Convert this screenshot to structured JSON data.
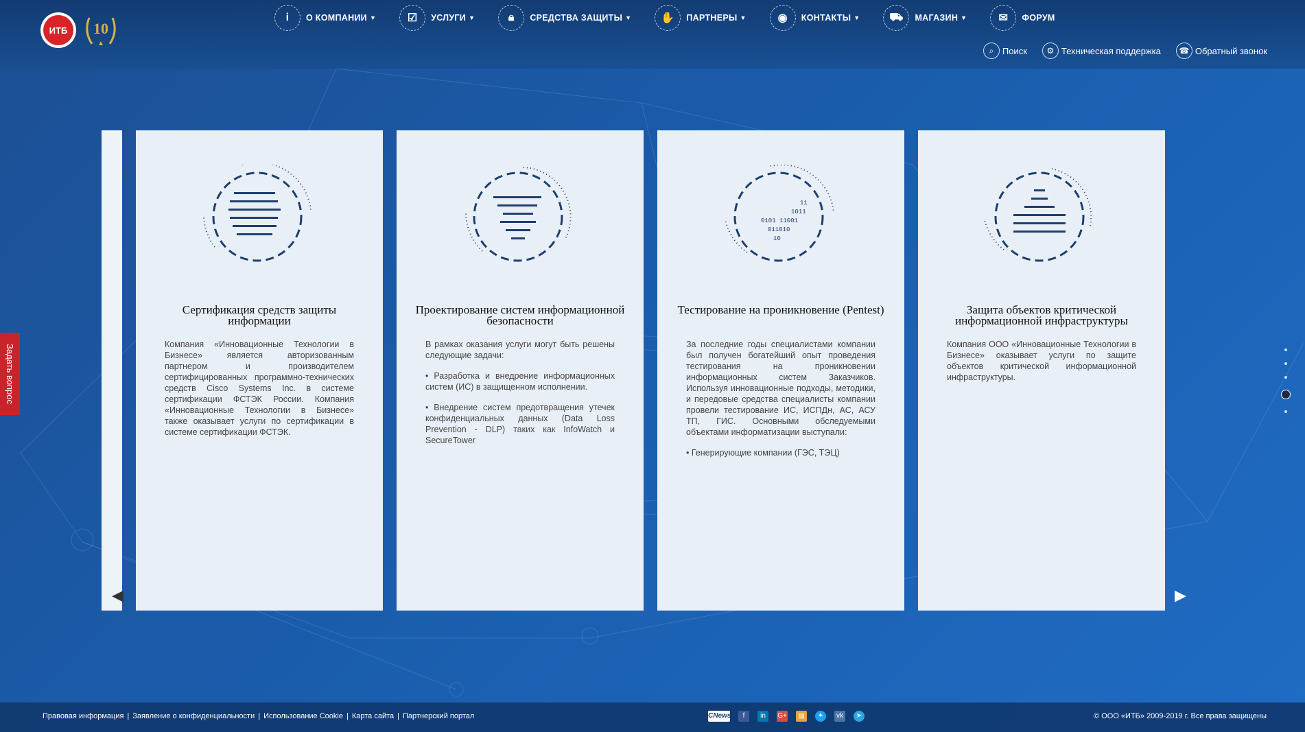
{
  "brand": {
    "logo_text": "ИТБ",
    "anniversary": "10"
  },
  "nav": [
    {
      "label": "О КОМПАНИИ",
      "icon": "info-icon"
    },
    {
      "label": "УСЛУГИ",
      "icon": "checklist-icon"
    },
    {
      "label": "СРЕДСТВА ЗАЩИТЫ",
      "icon": "lock-icon"
    },
    {
      "label": "ПАРТНЕРЫ",
      "icon": "handshake-icon"
    },
    {
      "label": "КОНТАКТЫ",
      "icon": "location-icon"
    },
    {
      "label": "МАГАЗИН",
      "icon": "cart-icon"
    },
    {
      "label": "ФОРУМ",
      "icon": "chat-icon"
    }
  ],
  "subnav": [
    {
      "label": "Поиск",
      "icon": "search-icon"
    },
    {
      "label": "Техническая поддержка",
      "icon": "gear-icon"
    },
    {
      "label": "Обратный звонок",
      "icon": "phone-icon"
    }
  ],
  "ask_tab": "Задать вопрос",
  "cards": [
    {
      "title": "Сертификация средств защиты информации",
      "paragraphs": [
        "Компания «Инновационные Технологии в Бизнесе» является авторизованным партнером и производителем сертифицированных программно-технических средств Cisco Systems Inc. в системе сертификации ФСТЭК России. Компания «Инновационные Технологии в Бизнесе» также оказывает услуги по сертификации в системе сертификации ФСТЭК."
      ],
      "bullets": []
    },
    {
      "title": "Проектирование систем информационной безопасности",
      "paragraphs": [
        "В рамках оказания услуги могут быть решены следующие задачи:"
      ],
      "bullets": [
        "Разработка и внедрение информационных систем (ИС) в защищенном исполнении.",
        "Внедрение систем предотвращения утечек конфиденциальных данных (Data Loss Prevention - DLP) таких как InfoWatch и SecureTower"
      ]
    },
    {
      "title": "Тестирование на проникновение (Pentest)",
      "paragraphs": [
        "За последние годы специалистами компании был получен богатейший опыт проведения тестирования на проникновении информационных систем Заказчиков. Используя инновационные подходы, методики, и передовые средства специалисты компании провели тестирование ИС, ИСПДн, АС, АСУ ТП, ГИС. Основными обследуемыми объектами информатизации выступали:"
      ],
      "bullets": [
        "Генерирующие компании (ГЭС, ТЭЦ)"
      ],
      "binary": [
        "11",
        "1011",
        "0101 11001",
        "011010",
        "10"
      ]
    },
    {
      "title": "Защита объектов критической информационной инфраструктуры",
      "paragraphs": [
        "Компания ООО «Инновационные Технологии в Бизнесе» оказывает услуги по защите объектов критической информационной инфраструктуры."
      ],
      "bullets": []
    }
  ],
  "footer": {
    "links": [
      "Правовая информация",
      "Заявление о конфиденциальности",
      "Использование Cookie",
      "Карта сайта",
      "Партнерский портал"
    ],
    "socials": [
      {
        "label": "CNews",
        "icon": "cnews-icon"
      },
      {
        "label": "f",
        "icon": "facebook-icon"
      },
      {
        "label": "in",
        "icon": "linkedin-icon"
      },
      {
        "label": "G+",
        "icon": "googleplus-icon"
      },
      {
        "label": "",
        "icon": "habr-icon"
      },
      {
        "label": "",
        "icon": "twitter-icon"
      },
      {
        "label": "vk",
        "icon": "vk-icon"
      },
      {
        "label": "",
        "icon": "telegram-icon"
      }
    ],
    "copyright": "© ООО «ИТБ» 2009-2019 г. Все права защищены"
  },
  "colors": {
    "accent_red": "#c9242b",
    "bg_blue": "#1a5cab",
    "card_bg": "#e9eff6",
    "ring_blue": "#1d3f6e"
  },
  "slider": {
    "dots_total": 5,
    "active_dot": 4
  }
}
